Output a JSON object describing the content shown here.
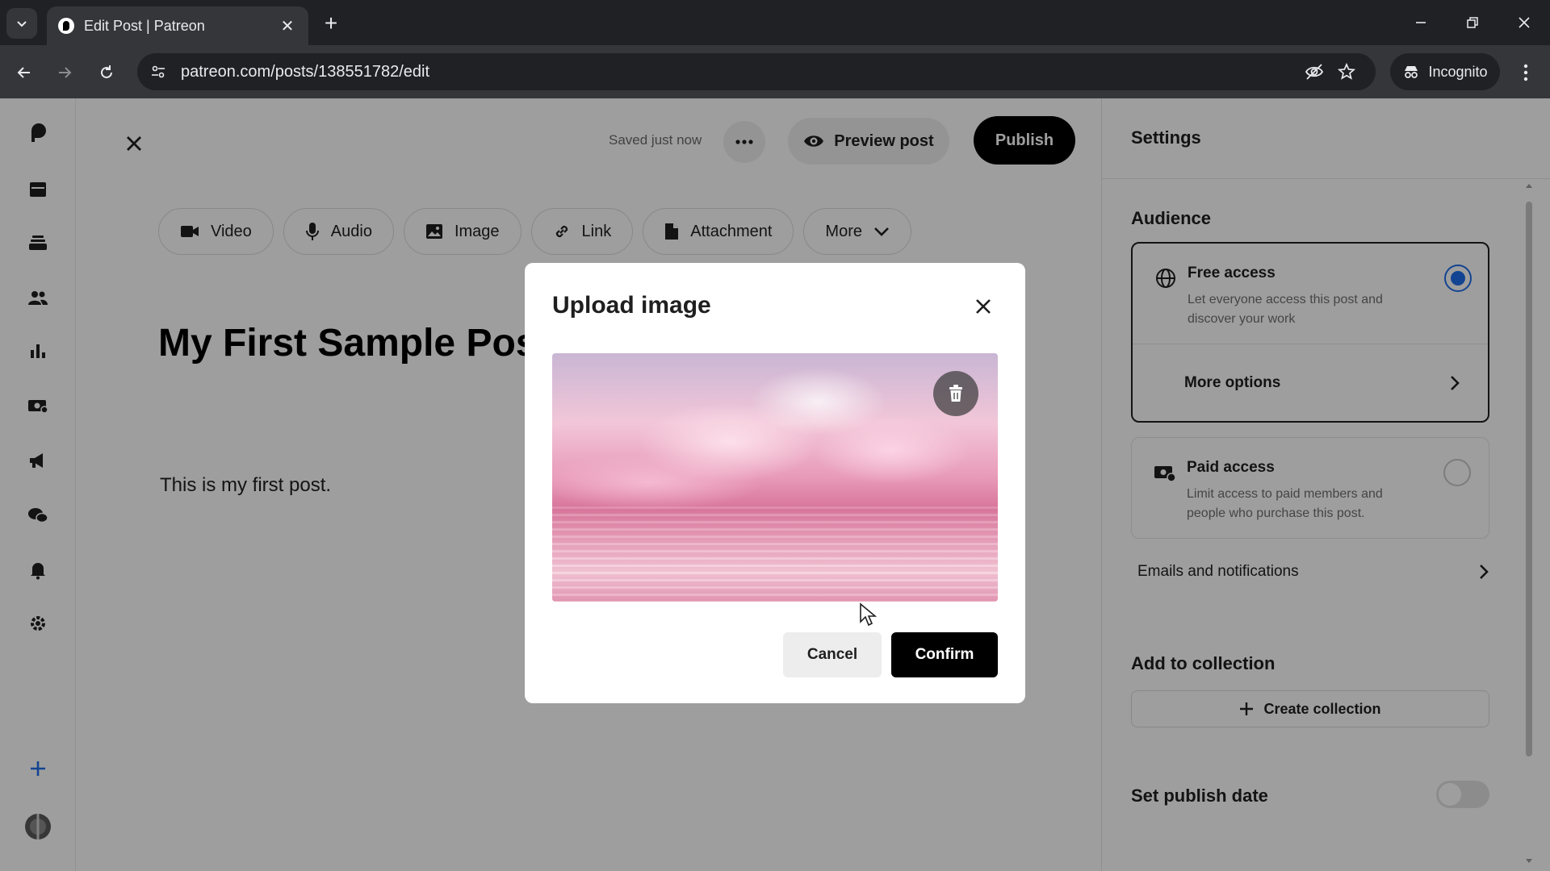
{
  "browser": {
    "tab_title": "Edit Post | Patreon",
    "url": "patreon.com/posts/138551782/edit",
    "incognito_label": "Incognito"
  },
  "editor": {
    "saved_status": "Saved just now",
    "preview_label": "Preview post",
    "publish_label": "Publish",
    "toolbar": [
      {
        "label": "Video",
        "icon": "video-icon"
      },
      {
        "label": "Audio",
        "icon": "mic-icon"
      },
      {
        "label": "Image",
        "icon": "image-icon"
      },
      {
        "label": "Link",
        "icon": "link-icon"
      },
      {
        "label": "Attachment",
        "icon": "file-icon"
      },
      {
        "label": "More",
        "icon": "chevron-down-icon"
      }
    ],
    "post_title": "My First Sample Post",
    "post_body": "This is my first post."
  },
  "settings": {
    "title": "Settings",
    "audience_title": "Audience",
    "free_access": {
      "name": "Free access",
      "desc": "Let everyone access this post and discover your work",
      "selected": true
    },
    "more_options": "More options",
    "paid_access": {
      "name": "Paid access",
      "desc": "Limit access to paid members and people who purchase this post.",
      "selected": false
    },
    "emails_label": "Emails and notifications",
    "collection_title": "Add to collection",
    "create_collection": "Create collection",
    "publish_date_label": "Set publish date",
    "publish_date_enabled": false
  },
  "modal": {
    "title": "Upload image",
    "cancel_label": "Cancel",
    "confirm_label": "Confirm"
  },
  "colors": {
    "accent": "#1f6feb",
    "primary_button": "#000000"
  }
}
